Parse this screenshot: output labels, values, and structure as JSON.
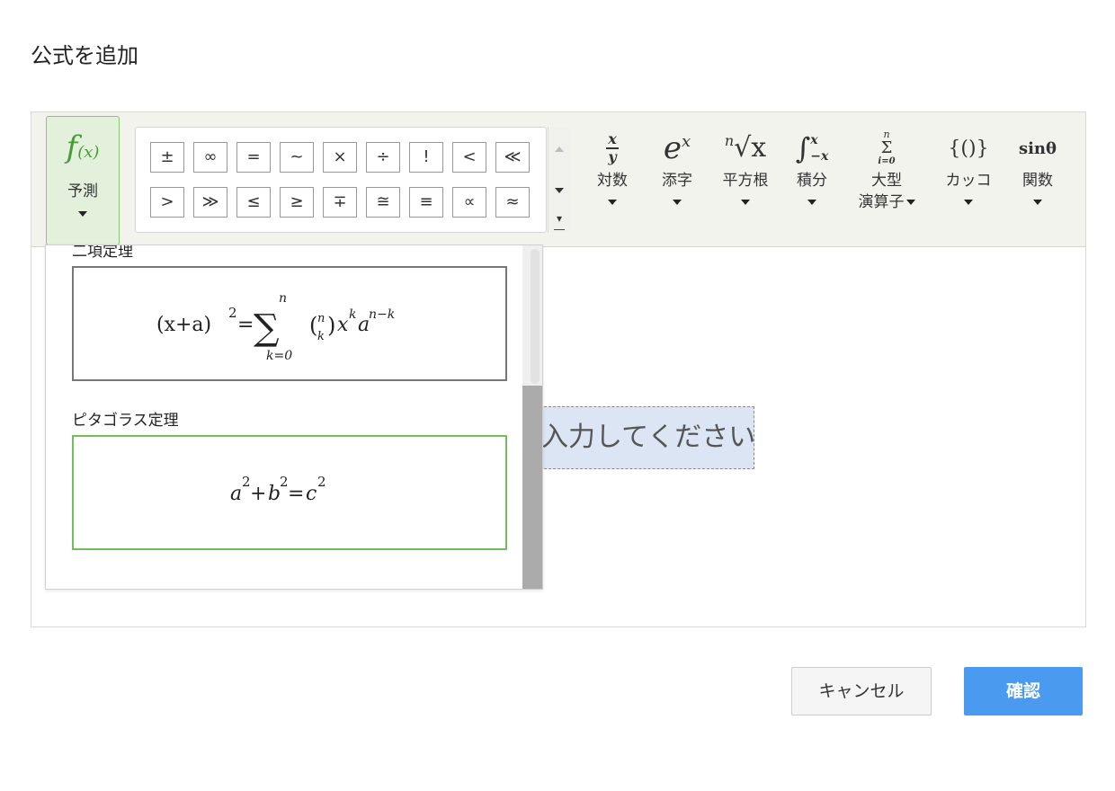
{
  "dialog": {
    "title": "公式を追加"
  },
  "toolbar": {
    "predict": {
      "glyph": "f",
      "glyph_small": "(x)",
      "label": "予測"
    },
    "symbols_row1": [
      "±",
      "∞",
      "=",
      "~",
      "×",
      "÷",
      "!",
      "<",
      "≪"
    ],
    "symbols_row2": [
      ">",
      "≫",
      "≤",
      "≥",
      "∓",
      "≅",
      "≡",
      "∝",
      "≈"
    ],
    "tools": [
      {
        "id": "log",
        "icon_num": "x",
        "icon_den": "y",
        "label": "対数"
      },
      {
        "id": "script",
        "icon": "e",
        "icon_sup": "x",
        "label": "添字"
      },
      {
        "id": "root",
        "icon_idx": "n",
        "icon_body": "√x",
        "label": "平方根"
      },
      {
        "id": "integral",
        "icon": "∫",
        "icon_sup": "x",
        "icon_sub": "−x",
        "label": "積分"
      },
      {
        "id": "large-op",
        "icon": "Σ",
        "icon_sup": "n",
        "icon_sub": "i=0",
        "label": "大型",
        "label2": "演算子"
      },
      {
        "id": "brackets",
        "icon": "{()}",
        "label": "カッコ"
      },
      {
        "id": "functions",
        "icon": "sinθ",
        "label": "関数"
      }
    ]
  },
  "workspace": {
    "placeholder": "入力してください"
  },
  "dropdown": {
    "items": [
      {
        "label": "二項定理",
        "formula": {
          "lhs": "(x+a)",
          "lhs_exp": "2",
          "eq": "=",
          "sum": "∑",
          "sum_top": "n",
          "sum_bottom": "k=0",
          "binom_top": "n",
          "binom_bottom": "k",
          "x": "x",
          "x_exp": "k",
          "a": "a",
          "a_exp": "n−k"
        }
      },
      {
        "label": "ピタゴラス定理",
        "formula": {
          "a": "a",
          "b": "b",
          "c": "c",
          "exp": "2",
          "plus": "+",
          "eq": "="
        }
      }
    ]
  },
  "buttons": {
    "cancel": "キャンセル",
    "confirm": "確認"
  },
  "colors": {
    "predict_bg": "#e2f0dc",
    "predict_border": "#8cc47a",
    "placeholder_bg": "#dce5f3",
    "confirm_bg": "#4a9af0",
    "selected_formula_border": "#74bd5c"
  }
}
